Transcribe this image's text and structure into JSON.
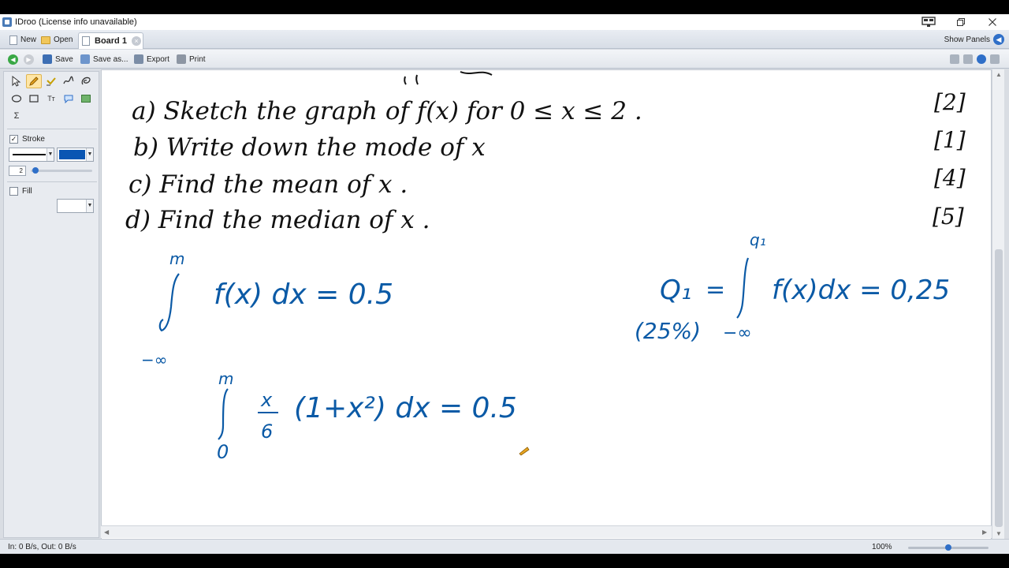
{
  "window": {
    "title": "IDroo (License info unavailable)",
    "controls": [
      "monitor",
      "restore",
      "close"
    ]
  },
  "tabs": {
    "new_label": "New",
    "open_label": "Open",
    "board_tab_label": "Board 1",
    "show_panels_label": "Show Panels"
  },
  "toolbar": {
    "save_label": "Save",
    "save_as_label": "Save as...",
    "export_label": "Export",
    "print_label": "Print"
  },
  "tools_panel": {
    "tools": [
      "select",
      "pen",
      "highlighter",
      "freehand",
      "eraser",
      "ellipse",
      "rectangle",
      "text",
      "comment",
      "image",
      "formula"
    ],
    "selected_tool": "pen",
    "text_tool_glyph": "Tт",
    "formula_glyph": "Σ",
    "stroke_label": "Stroke",
    "stroke_checked": true,
    "stroke_color": "#0a56b3",
    "stroke_width_value": "2",
    "fill_label": "Fill",
    "fill_checked": false
  },
  "board": {
    "ink_color": "#0b5aa6",
    "questions": [
      {
        "text": "a) Sketch the graph of f(x)  for 0 ≤ x ≤ 2 .",
        "marks": "[2]"
      },
      {
        "text": "b) Write down the mode of x",
        "marks": "[1]"
      },
      {
        "text": "c) Find the mean of x .",
        "marks": "[4]"
      },
      {
        "text": "d) Find the median of x .",
        "marks": "[5]"
      }
    ],
    "ink_notes": {
      "median_integral_upper": "m",
      "median_integral_lower": "−∞",
      "median_integral_body": "f(x) dx = 0.5",
      "q1_label": "Q₁",
      "q1_percent": "(25%)",
      "q1_upper": "q₁",
      "q1_lower": "−∞",
      "q1_equals": "=",
      "q1_body": "f(x)dx = 0,25",
      "work_upper": "m",
      "work_lower": "0",
      "work_frac_num": "x",
      "work_frac_den": "6",
      "work_body": "(1+x²) dx = 0.5"
    }
  },
  "status": {
    "io_text": "In: 0 B/s, Out: 0 B/s",
    "zoom_text": "100%",
    "zoom_level": 0.5
  }
}
